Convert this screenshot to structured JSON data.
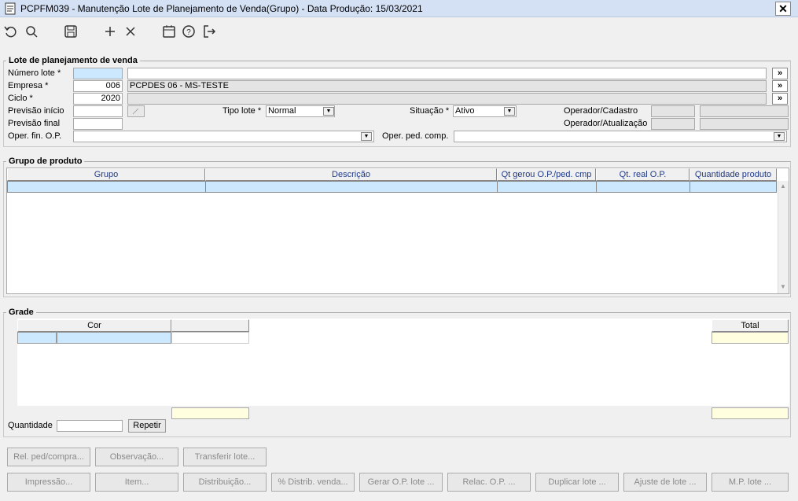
{
  "window": {
    "title": "PCPFM039 - Manutenção Lote de Planejamento de Venda(Grupo) - Data Produção: 15/03/2021",
    "close": "✕"
  },
  "toolbar": {
    "undo": "↺",
    "search": "⌕",
    "save": "🖫",
    "add": "+",
    "delete": "✕",
    "calendar": "📅",
    "help": "?",
    "exit": "⇥"
  },
  "lote": {
    "legend": "Lote de planejamento de venda",
    "numero_label": "Número lote *",
    "numero_value": "",
    "empresa_label": "Empresa *",
    "empresa_code": "006",
    "empresa_name": "PCPDES 06 - MS-TESTE",
    "ciclo_label": "Ciclo *",
    "ciclo_value": "2020",
    "prev_inicio_label": "Previsão início",
    "prev_final_label": "Previsão final",
    "tipo_label": "Tipo lote *",
    "tipo_value": "Normal",
    "situacao_label": "Situação *",
    "situacao_value": "Ativo",
    "op_cadastro_label": "Operador/Cadastro",
    "op_atualizacao_label": "Operador/Atualização",
    "oper_fin_label": "Oper. fin. O.P.",
    "oper_ped_label": "Oper. ped. comp.",
    "expand_btn": "»"
  },
  "grupo": {
    "legend": "Grupo de produto",
    "columns": [
      "Grupo",
      "Descrição",
      "Qt gerou O.P./ped. cmp",
      "Qt. real O.P.",
      "Quantidade produto"
    ]
  },
  "grade": {
    "legend": "Grade",
    "cor_header": "Cor",
    "total_header": "Total",
    "quantidade_label": "Quantidade",
    "repetir_button": "Repetir"
  },
  "buttons_row1": [
    "Rel. ped/compra...",
    "Observação...",
    "Transferir lote..."
  ],
  "buttons_row2": [
    "Impressão...",
    "Item...",
    "Distribuição...",
    "% Distrib. venda...",
    "Gerar O.P. lote ...",
    "Relac. O.P. ...",
    "Duplicar lote ...",
    "Ajuste de lote ...",
    "M.P. lote ..."
  ],
  "colors": {
    "selection_row": "#cce8ff",
    "total_cell": "#ffffe0",
    "header_text": "#1f3a8a"
  }
}
